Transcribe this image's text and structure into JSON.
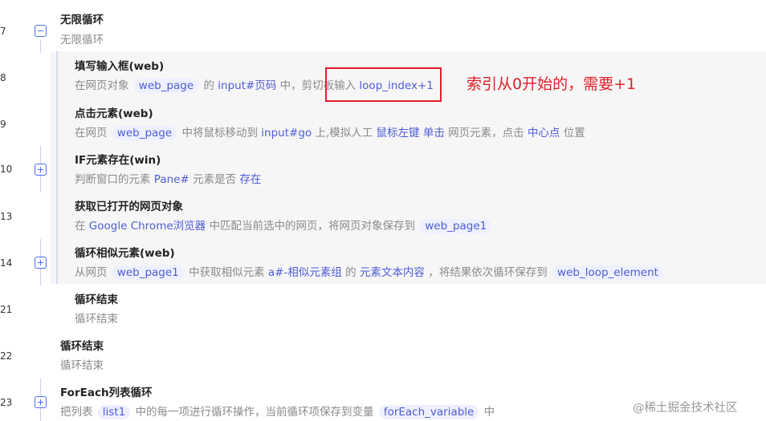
{
  "steps": [
    {
      "line": "7",
      "toggle": "minus",
      "title": "无限循环",
      "desc": [
        "无限循环"
      ]
    },
    {
      "line": "8",
      "title": "填写输入框(web)",
      "desc": [
        "在网页对象",
        "web_page",
        "的",
        "input#页码",
        "中，剪切板输入",
        "loop_index+1"
      ]
    },
    {
      "line": "9",
      "title": "点击元素(web)",
      "desc": [
        "在网页",
        "web_page",
        "中将鼠标移动到",
        "input#go",
        "上,模拟人工",
        "鼠标左键",
        "单击",
        "网页元素，点击",
        "中心点",
        "位置"
      ]
    },
    {
      "line": "10",
      "toggle": "plus",
      "title": "IF元素存在(win)",
      "desc": [
        "判断窗口的元素",
        "Pane#",
        "元素是否",
        "存在"
      ]
    },
    {
      "line": "13",
      "title": "获取已打开的网页对象",
      "desc": [
        "在",
        "Google Chrome浏览器",
        "中匹配当前选中的网页，将网页对象保存到",
        "web_page1"
      ]
    },
    {
      "line": "14",
      "toggle": "plus",
      "title": "循环相似元素(web)",
      "desc": [
        "从网页",
        "web_page1",
        "中获取相似元素",
        "a#-相似元素组",
        "的",
        "元素文本内容",
        "，将结果依次循环保存到",
        "web_loop_element"
      ]
    },
    {
      "line": "21",
      "title": "循环结束",
      "desc": [
        "循环结束"
      ]
    },
    {
      "line": "22",
      "title": "循环结束",
      "desc": [
        "循环结束"
      ]
    },
    {
      "line": "23",
      "toggle": "plus",
      "title": "ForEach列表循环",
      "desc": [
        "把列表",
        "list1",
        "中的每一项进行循环操作，当前循环项保存到变量",
        "forEach_variable",
        "中"
      ]
    }
  ],
  "annotation": {
    "note": "索引从0开始的，需要+1"
  },
  "watermark": "@稀土掘金技术社区",
  "colors": {
    "accent": "#4f5cd6",
    "annotation": "#e0202a",
    "chip_bg": "#eef0ff"
  },
  "icons": {
    "collapse": "minus-square-icon",
    "expand": "plus-square-icon"
  }
}
